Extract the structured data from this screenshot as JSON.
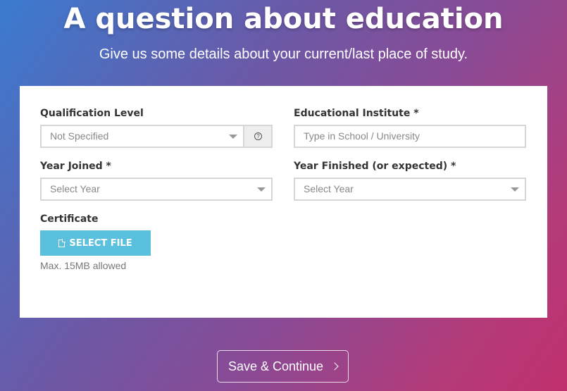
{
  "header": {
    "title": "A question about education",
    "subtitle": "Give us some details about your current/last place of study."
  },
  "form": {
    "qualification": {
      "label": "Qualification Level",
      "value": "Not Specified",
      "help_icon": "question-circle-icon"
    },
    "institute": {
      "label": "Educational Institute *",
      "placeholder": "Type in School / University"
    },
    "year_joined": {
      "label": "Year Joined *",
      "value": "Select Year"
    },
    "year_finished": {
      "label": "Year Finished (or expected) *",
      "value": "Select Year"
    },
    "certificate": {
      "label": "Certificate",
      "button_label": "SELECT FILE",
      "button_icon": "file-icon",
      "hint": "Max. 15MB allowed",
      "button_color": "#5bc0de"
    }
  },
  "footer": {
    "save_label": "Save & Continue",
    "save_icon": "chevron-right-icon"
  }
}
